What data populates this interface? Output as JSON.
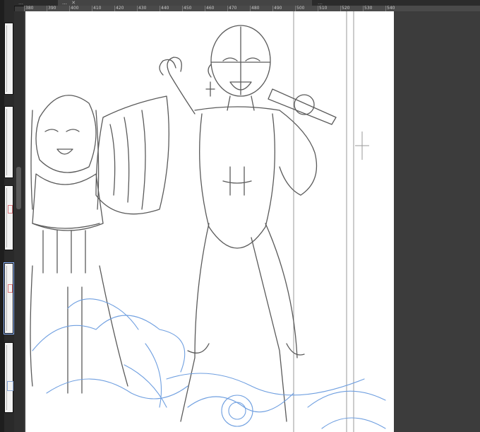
{
  "tabs": [
    {
      "label": "…",
      "active": false
    },
    {
      "label": "…",
      "active": true
    },
    {
      "label": "…",
      "active": false
    }
  ],
  "ruler": {
    "labels": [
      "380",
      "390",
      "400",
      "410",
      "420",
      "430",
      "440",
      "450",
      "460",
      "470",
      "480",
      "490",
      "500",
      "510",
      "520",
      "530",
      "540"
    ]
  },
  "colors": {
    "pencil": "#5a5a5a",
    "blue_pencil": "#6f9fe0",
    "guide": "#9a9a9a",
    "workspace": "#3c3c3c"
  }
}
